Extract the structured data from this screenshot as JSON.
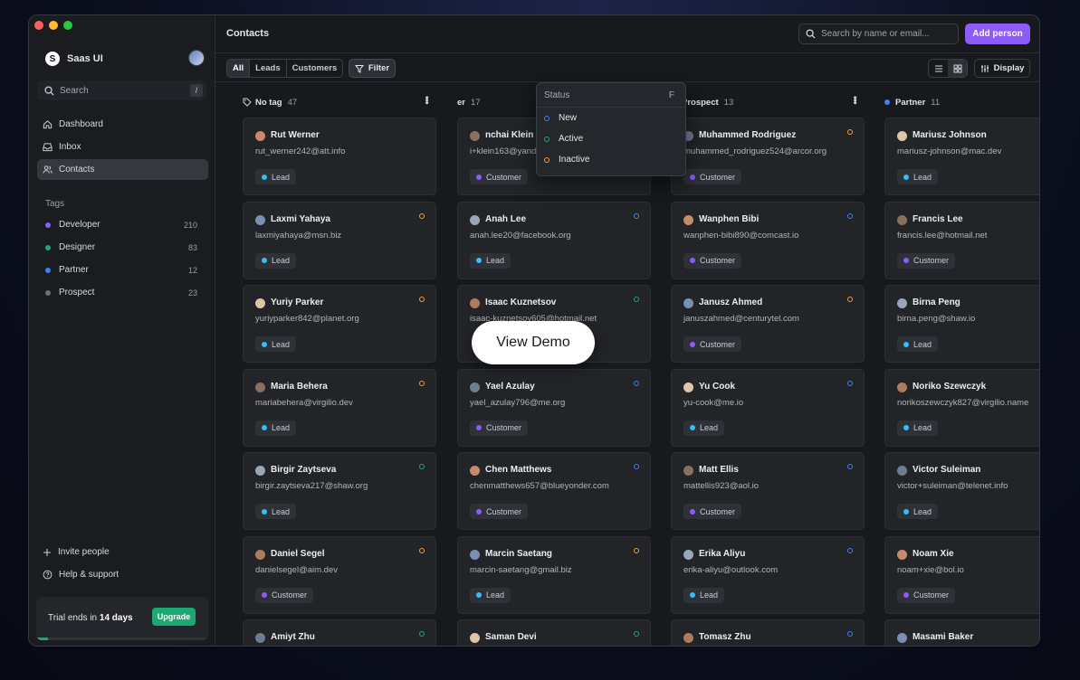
{
  "window": {
    "lights": [
      "#ff5f57",
      "#febc2e",
      "#28c840"
    ]
  },
  "sidebar": {
    "brand": "Saas UI",
    "brand_logo_glyph": "S",
    "search_placeholder": "Search",
    "search_shortcut": "/",
    "nav": [
      {
        "label": "Dashboard",
        "icon": "home-icon"
      },
      {
        "label": "Inbox",
        "icon": "inbox-icon"
      },
      {
        "label": "Contacts",
        "icon": "users-icon",
        "active": true
      }
    ],
    "tags_heading": "Tags",
    "tags": [
      {
        "label": "Developer",
        "count": "210",
        "color": "#8b5cf6"
      },
      {
        "label": "Designer",
        "count": "83",
        "color": "#19a971"
      },
      {
        "label": "Partner",
        "count": "12",
        "color": "#3b82f6"
      },
      {
        "label": "Prospect",
        "count": "23",
        "color": "#6b7280"
      }
    ],
    "bottom": [
      {
        "label": "Invite people",
        "icon": "plus-icon"
      },
      {
        "label": "Help & support",
        "icon": "help-circle-icon"
      }
    ],
    "trial_prefix": "Trial ends in",
    "trial_days": "14 days",
    "upgrade_label": "Upgrade",
    "trial_progress": 0.07
  },
  "header": {
    "title": "Contacts",
    "search_placeholder": "Search by name or email...",
    "add_label": "Add person"
  },
  "toolbar": {
    "segments": [
      {
        "label": "All",
        "active": true
      },
      {
        "label": "Leads"
      },
      {
        "label": "Customers"
      }
    ],
    "filter_label": "Filter",
    "display_label": "Display"
  },
  "filter_menu": {
    "heading": "Status",
    "shortcut": "F",
    "options": [
      {
        "label": "New",
        "color": "#3b82f6"
      },
      {
        "label": "Active",
        "color": "#19a971"
      },
      {
        "label": "Inactive",
        "color": "#f59e42"
      }
    ]
  },
  "demo_button": "View Demo",
  "colors": {
    "new": "#3b82f6",
    "active": "#19a971",
    "inactive": "#f59e42",
    "lead": "#38bdf8",
    "customer": "#8b5cf6"
  },
  "columns": [
    {
      "title": "No tag",
      "count": "47",
      "marker": "tag-icon",
      "cards": [
        {
          "name": "Rut Werner",
          "email": "rut_werner242@att.info",
          "type": "Lead",
          "status": ""
        },
        {
          "name": "Laxmi Yahaya",
          "email": "laxmiyahaya@msn.biz",
          "type": "Lead",
          "status": "inactive"
        },
        {
          "name": "Yuriy Parker",
          "email": "yuriyparker842@planet.org",
          "type": "Lead",
          "status": "inactive"
        },
        {
          "name": "Maria Behera",
          "email": "mariabehera@virgilio.dev",
          "type": "Lead",
          "status": "inactive"
        },
        {
          "name": "Birgir Zaytseva",
          "email": "birgir.zaytseva217@shaw.org",
          "type": "Lead",
          "status": "active"
        },
        {
          "name": "Daniel Segel",
          "email": "danielsegel@aim.dev",
          "type": "Customer",
          "status": "inactive"
        },
        {
          "name": "Amiyt Zhu",
          "email": "",
          "type": "",
          "status": "active"
        }
      ]
    },
    {
      "title": "er",
      "count": "17",
      "marker": "",
      "cards": [
        {
          "name": "nchai Klein",
          "email": "i+klein163@yandex.com",
          "type": "Customer",
          "status": "active"
        },
        {
          "name": "Anah Lee",
          "email": "anah.lee20@facebook.org",
          "type": "Lead",
          "status": "new"
        },
        {
          "name": "Isaac Kuznetsov",
          "email": "isaac-kuznetsov605@hotmail.net",
          "type": "",
          "status": "active"
        },
        {
          "name": "Yael Azulay",
          "email": "yael_azulay796@me.org",
          "type": "Customer",
          "status": "new"
        },
        {
          "name": "Chen Matthews",
          "email": "chenmatthews657@blueyonder.com",
          "type": "Customer",
          "status": "new"
        },
        {
          "name": "Marcin Saetang",
          "email": "marcin-saetang@gmail.biz",
          "type": "Lead",
          "status": "inactive"
        },
        {
          "name": "Saman Devi",
          "email": "",
          "type": "",
          "status": "active"
        }
      ]
    },
    {
      "title": "Prospect",
      "count": "13",
      "marker": "#6b7280",
      "cards": [
        {
          "name": "Muhammed Rodriguez",
          "email": "muhammed_rodriguez524@arcor.org",
          "type": "Customer",
          "status": "inactive"
        },
        {
          "name": "Wanphen Bibi",
          "email": "wanphen-bibi890@comcast.io",
          "type": "Customer",
          "status": "new"
        },
        {
          "name": "Janusz Ahmed",
          "email": "januszahmed@centurytel.com",
          "type": "Customer",
          "status": "inactive"
        },
        {
          "name": "Yu Cook",
          "email": "yu-cook@me.io",
          "type": "Lead",
          "status": "new"
        },
        {
          "name": "Matt Ellis",
          "email": "mattellis923@aol.io",
          "type": "Customer",
          "status": "new"
        },
        {
          "name": "Erika Aliyu",
          "email": "erika-aliyu@outlook.com",
          "type": "Lead",
          "status": "new"
        },
        {
          "name": "Tomasz Zhu",
          "email": "",
          "type": "",
          "status": "new"
        }
      ]
    },
    {
      "title": "Partner",
      "count": "11",
      "marker": "#3b82f6",
      "cards": [
        {
          "name": "Mariusz Johnson",
          "email": "mariusz-johnson@mac.dev",
          "type": "Lead",
          "status": ""
        },
        {
          "name": "Francis Lee",
          "email": "francis.lee@hotmail.net",
          "type": "Customer",
          "status": ""
        },
        {
          "name": "Birna Peng",
          "email": "birna.peng@shaw.io",
          "type": "Lead",
          "status": ""
        },
        {
          "name": "Noriko Szewczyk",
          "email": "norikoszewczyk827@virgilio.name",
          "type": "Lead",
          "status": ""
        },
        {
          "name": "Victor Suleiman",
          "email": "victor+suleiman@telenet.info",
          "type": "Lead",
          "status": ""
        },
        {
          "name": "Noam Xie",
          "email": "noam+xie@bol.io",
          "type": "Customer",
          "status": ""
        },
        {
          "name": "Masami Baker",
          "email": "",
          "type": "",
          "status": ""
        }
      ]
    }
  ]
}
